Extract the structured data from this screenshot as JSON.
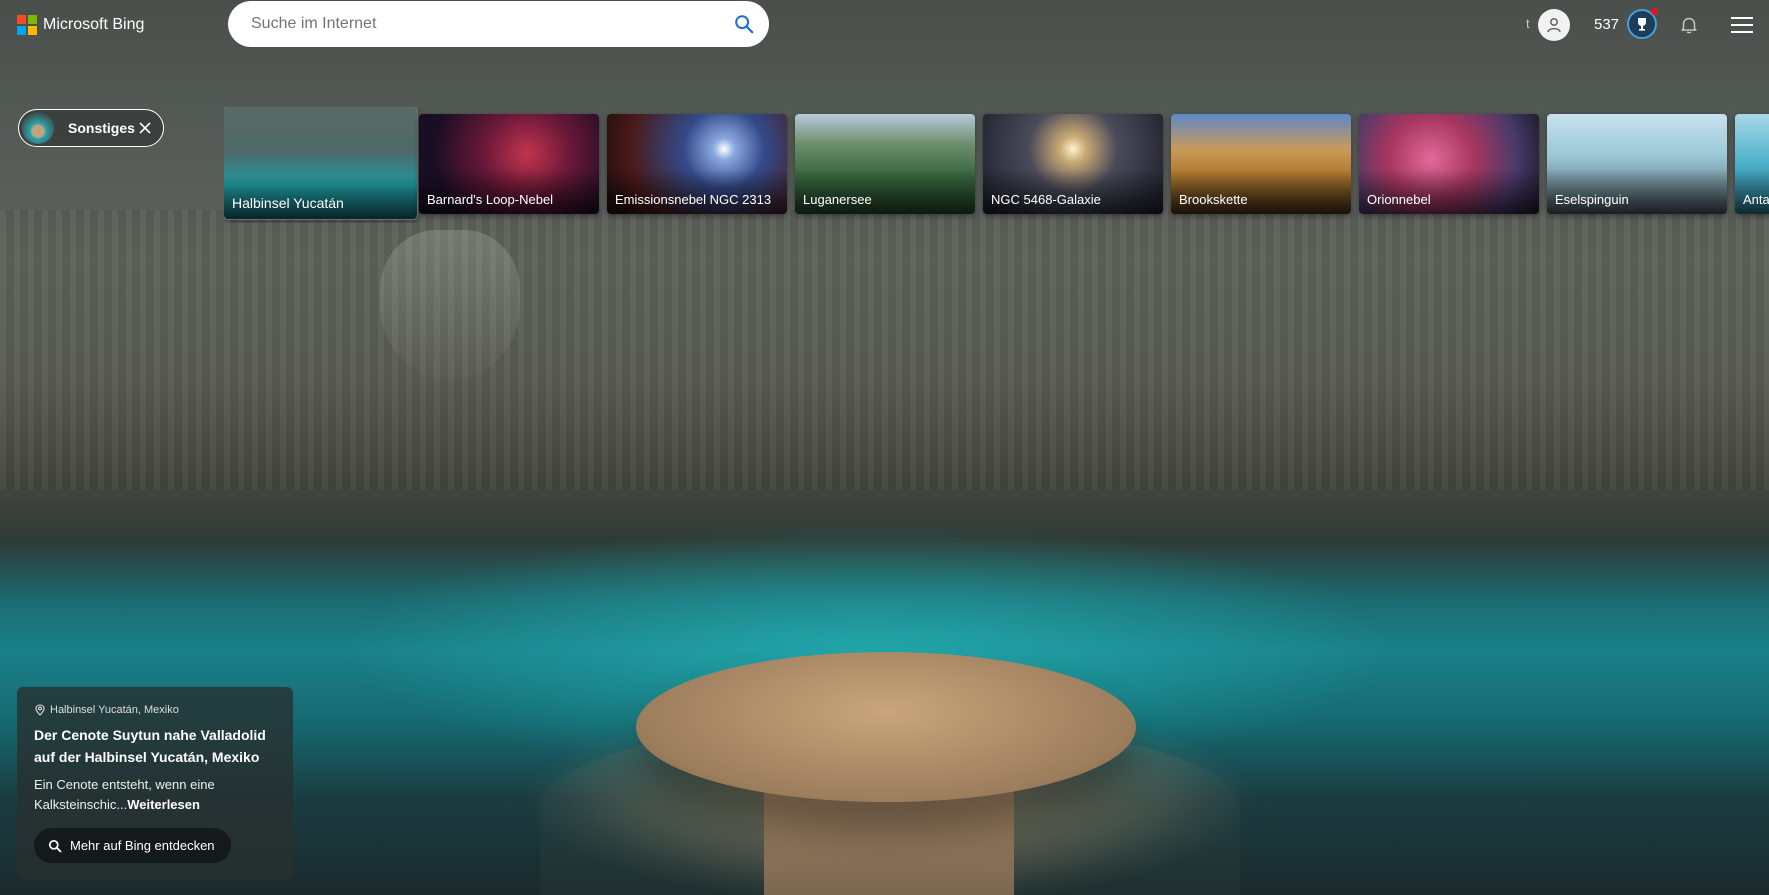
{
  "header": {
    "logo_text": "Microsoft Bing",
    "search_placeholder": "Suche im Internet",
    "user_initial": "t",
    "reward_points": "537"
  },
  "filter_chip": {
    "label": "Sonstiges"
  },
  "carousel": {
    "items": [
      {
        "label": "Halbinsel Yucatán",
        "active": true,
        "gradient": "linear-gradient(180deg,#5a6a66 0%,#4d6a68 40%,#1f9aa0 70%,#146d75 100%)"
      },
      {
        "label": "Barnard's Loop-Nebel",
        "active": false,
        "gradient": "radial-gradient(circle at 60% 40%,#c2344e 0%,#6a1838 35%,#1a0e25 75%)"
      },
      {
        "label": "Emissionsnebel NGC 2313",
        "active": false,
        "gradient": "radial-gradient(circle at 65% 35%,#ffffff 0%,#8aa8e0 8%,#334a8a 30%,#4a1a18 70%,#1c0c0c 100%)"
      },
      {
        "label": "Luganersee",
        "active": false,
        "gradient": "linear-gradient(180deg,#b7c9d8 0%,#6c8e6c 30%,#3a6a42 60%,#244a2a 100%)"
      },
      {
        "label": "NGC 5468-Galaxie",
        "active": false,
        "gradient": "radial-gradient(circle at 50% 35%,#fff2cc 0%,#c8a874 12%,#4a4a5a 40%,#1c1c28 100%)"
      },
      {
        "label": "Brookskette",
        "active": false,
        "gradient": "linear-gradient(180deg,#5c88c8 0%,#c99a5a 35%,#b07a30 60%,#4a3418 100%)"
      },
      {
        "label": "Orionnebel",
        "active": false,
        "gradient": "radial-gradient(circle at 40% 45%,#e06a9a 0%,#a8365e 35%,#4a3a6a 70%,#1a1a2a 100%)"
      },
      {
        "label": "Eselspinguin",
        "active": false,
        "gradient": "linear-gradient(180deg,#c8e2ee 0%,#9cc8d8 40%,#6e8a96 75%,#4a5a62 100%)"
      },
      {
        "label": "Antarktis",
        "active": false,
        "gradient": "linear-gradient(180deg,#a8d8e8 0%,#4ab0c8 50%,#2a7a90 100%)"
      }
    ]
  },
  "info_panel": {
    "location": "Halbinsel Yucatán, Mexiko",
    "title": "Der Cenote Suytun nahe Valladolid auf der Halbinsel Yucatán, Mexiko",
    "description": "Ein Cenote entsteht, wenn eine Kalksteinschic...",
    "read_more": "Weiterlesen",
    "discover_button": "Mehr auf Bing entdecken"
  },
  "icons": {
    "search": "search-icon",
    "avatar": "user-icon",
    "rewards": "trophy-icon",
    "notifications": "bell-icon",
    "menu": "hamburger-icon",
    "chip_close": "close-icon",
    "location": "pin-icon"
  }
}
